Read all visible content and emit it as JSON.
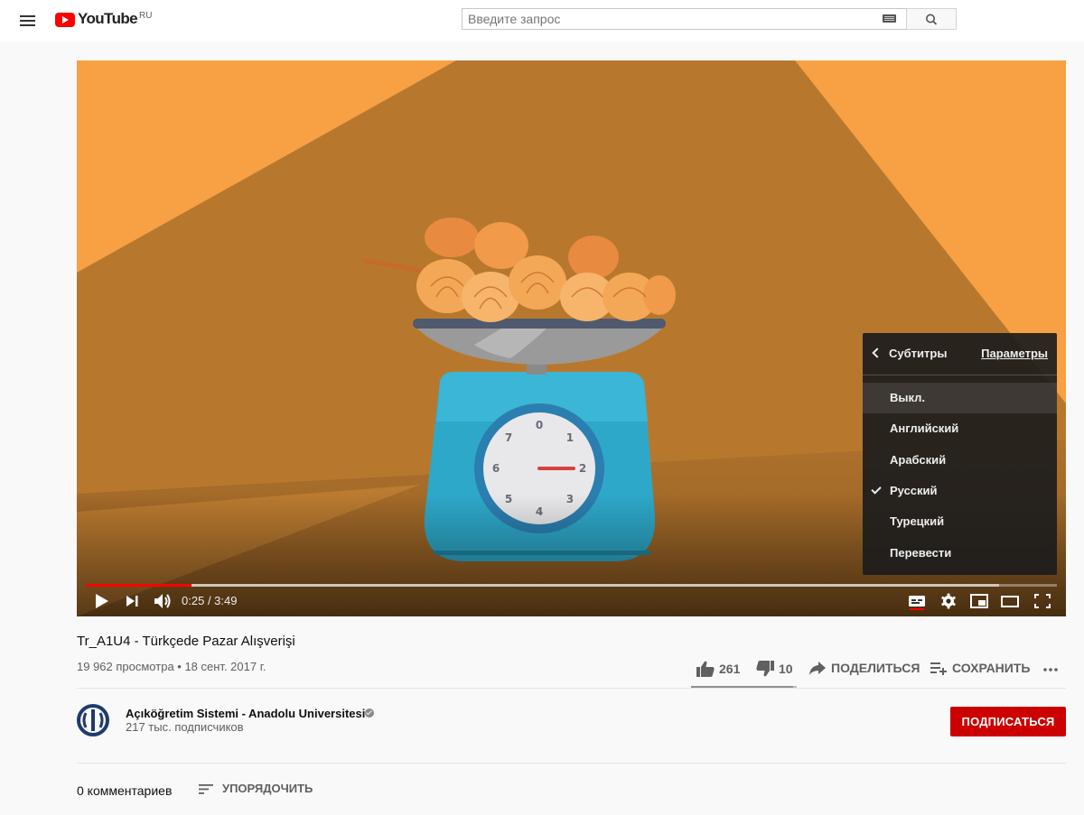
{
  "masthead": {
    "logo_text": "YouTube",
    "logo_region": "RU",
    "search_placeholder": "Введите запрос",
    "search_value": ""
  },
  "player": {
    "current_time": "0:25",
    "duration": "3:49",
    "progress_fraction": 0.109,
    "buffered_fraction": 0.94,
    "scale_dial_numbers": [
      "0",
      "1",
      "2",
      "3",
      "4",
      "5",
      "6",
      "7"
    ],
    "subtitles_menu": {
      "title": "Субтитры",
      "options_link": "Параметры",
      "items": [
        {
          "label": "Выкл.",
          "selected": false,
          "highlighted": true
        },
        {
          "label": "Английский",
          "selected": false,
          "highlighted": false
        },
        {
          "label": "Арабский",
          "selected": false,
          "highlighted": false
        },
        {
          "label": "Русский",
          "selected": true,
          "highlighted": false
        },
        {
          "label": "Турецкий",
          "selected": false,
          "highlighted": false
        },
        {
          "label": "Перевести",
          "selected": false,
          "highlighted": false
        }
      ]
    },
    "icons": [
      "play-icon",
      "next-icon",
      "volume-icon",
      "subtitles-icon",
      "gear-icon",
      "miniplayer-icon",
      "theater-icon",
      "fullscreen-icon"
    ]
  },
  "video": {
    "title": "Tr_A1U4 - Türkçede Pazar Alışverişi",
    "meta": "19 962 просмотра • 18 сент. 2017 г.",
    "likes": "261",
    "dislikes": "10",
    "like_fraction": 0.963,
    "share_label": "ПОДЕЛИТЬСЯ",
    "save_label": "СОХРАНИТЬ"
  },
  "channel": {
    "name": "Açıköğretim Sistemi - Anadolu Universitesi",
    "subscribers": "217 тыс. подписчиков",
    "subscribe_label": "ПОДПИСАТЬСЯ"
  },
  "comments": {
    "count_label": "0 комментариев",
    "sort_label": "УПОРЯДОЧИТЬ"
  },
  "colors": {
    "accent_red": "#ff0000",
    "subscribe_red": "#cc0000",
    "video_bg_orange": "#f7a044",
    "video_bg_brown": "#b7782e",
    "scale_blue": "#2ea8c9"
  }
}
